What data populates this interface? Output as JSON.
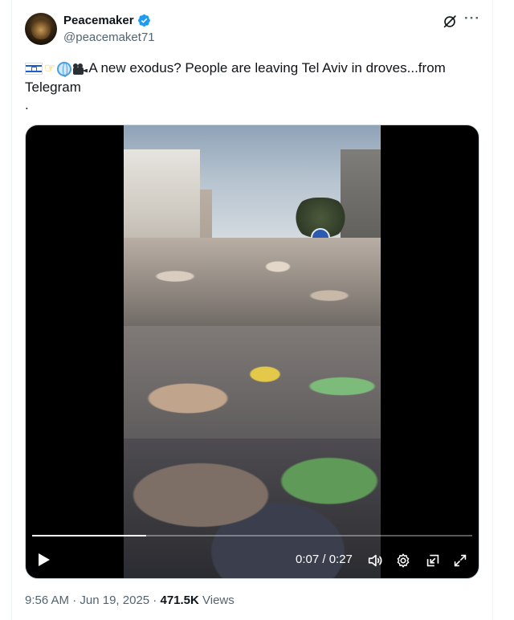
{
  "author": {
    "display_name": "Peacemaker",
    "handle": "@peacemaket71",
    "verified": true,
    "verified_color": "#1d9bf0"
  },
  "tweet": {
    "emojis": [
      "israel-flag",
      "backhand-index-pointing-right",
      "globe-with-meridians",
      "movie-camera"
    ],
    "text": "A new exodus? People are leaving Tel Aviv in droves...from Telegram",
    "extra_line": "."
  },
  "video": {
    "time_display": "0:07 / 0:27",
    "progress": 0.26,
    "controls": [
      "play-icon",
      "volume-icon",
      "settings-icon",
      "pip-icon",
      "fullscreen-icon"
    ]
  },
  "footer": {
    "time": "9:56 AM",
    "sep1": " · ",
    "date": "Jun 19, 2025",
    "sep2": " · ",
    "views_count": "471.5K",
    "views_label": " Views"
  }
}
